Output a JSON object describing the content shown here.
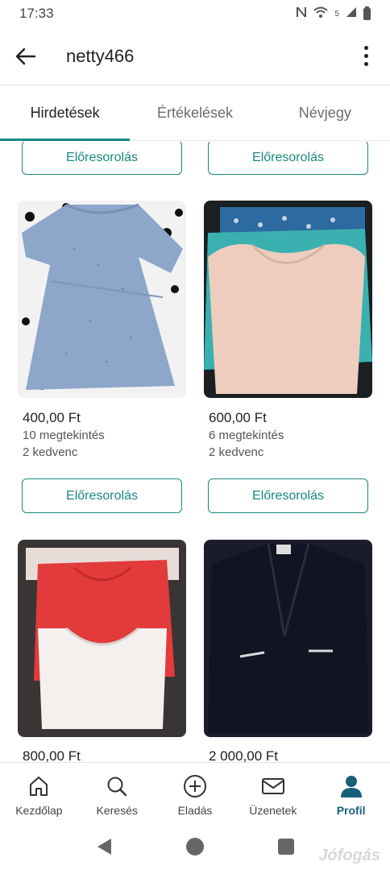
{
  "status": {
    "time": "17:33",
    "network": "5",
    "icons": [
      "nfc-icon",
      "wifi-icon",
      "signal-icon",
      "battery-icon"
    ]
  },
  "header": {
    "title": "netty466"
  },
  "tabs": [
    {
      "label": "Hirdetések",
      "active": true
    },
    {
      "label": "Értékelések",
      "active": false
    },
    {
      "label": "Névjegy",
      "active": false
    }
  ],
  "listing": {
    "promo_label": "Előresorolás",
    "items": [
      {
        "price": "400,00 Ft",
        "views": "10 megtekintés",
        "favs": "2 kedvenc",
        "image": "light-blue-dress"
      },
      {
        "price": "600,00 Ft",
        "views": "6 megtekintés",
        "favs": "2 kedvenc",
        "image": "beige-and-teal-tops"
      },
      {
        "price": "800,00 Ft",
        "image": "red-and-white-tops"
      },
      {
        "price": "2 000,00 Ft",
        "image": "black-jacket"
      }
    ]
  },
  "bottom_nav": [
    {
      "label": "Kezdőlap",
      "icon": "home-icon"
    },
    {
      "label": "Keresés",
      "icon": "search-icon"
    },
    {
      "label": "Eladás",
      "icon": "add-circle-icon"
    },
    {
      "label": "Üzenetek",
      "icon": "mail-icon"
    },
    {
      "label": "Profil",
      "icon": "profile-icon",
      "active": true
    }
  ],
  "watermark": "Jófogás",
  "colors": {
    "accent": "#178a7f",
    "active_nav": "#17607a"
  }
}
